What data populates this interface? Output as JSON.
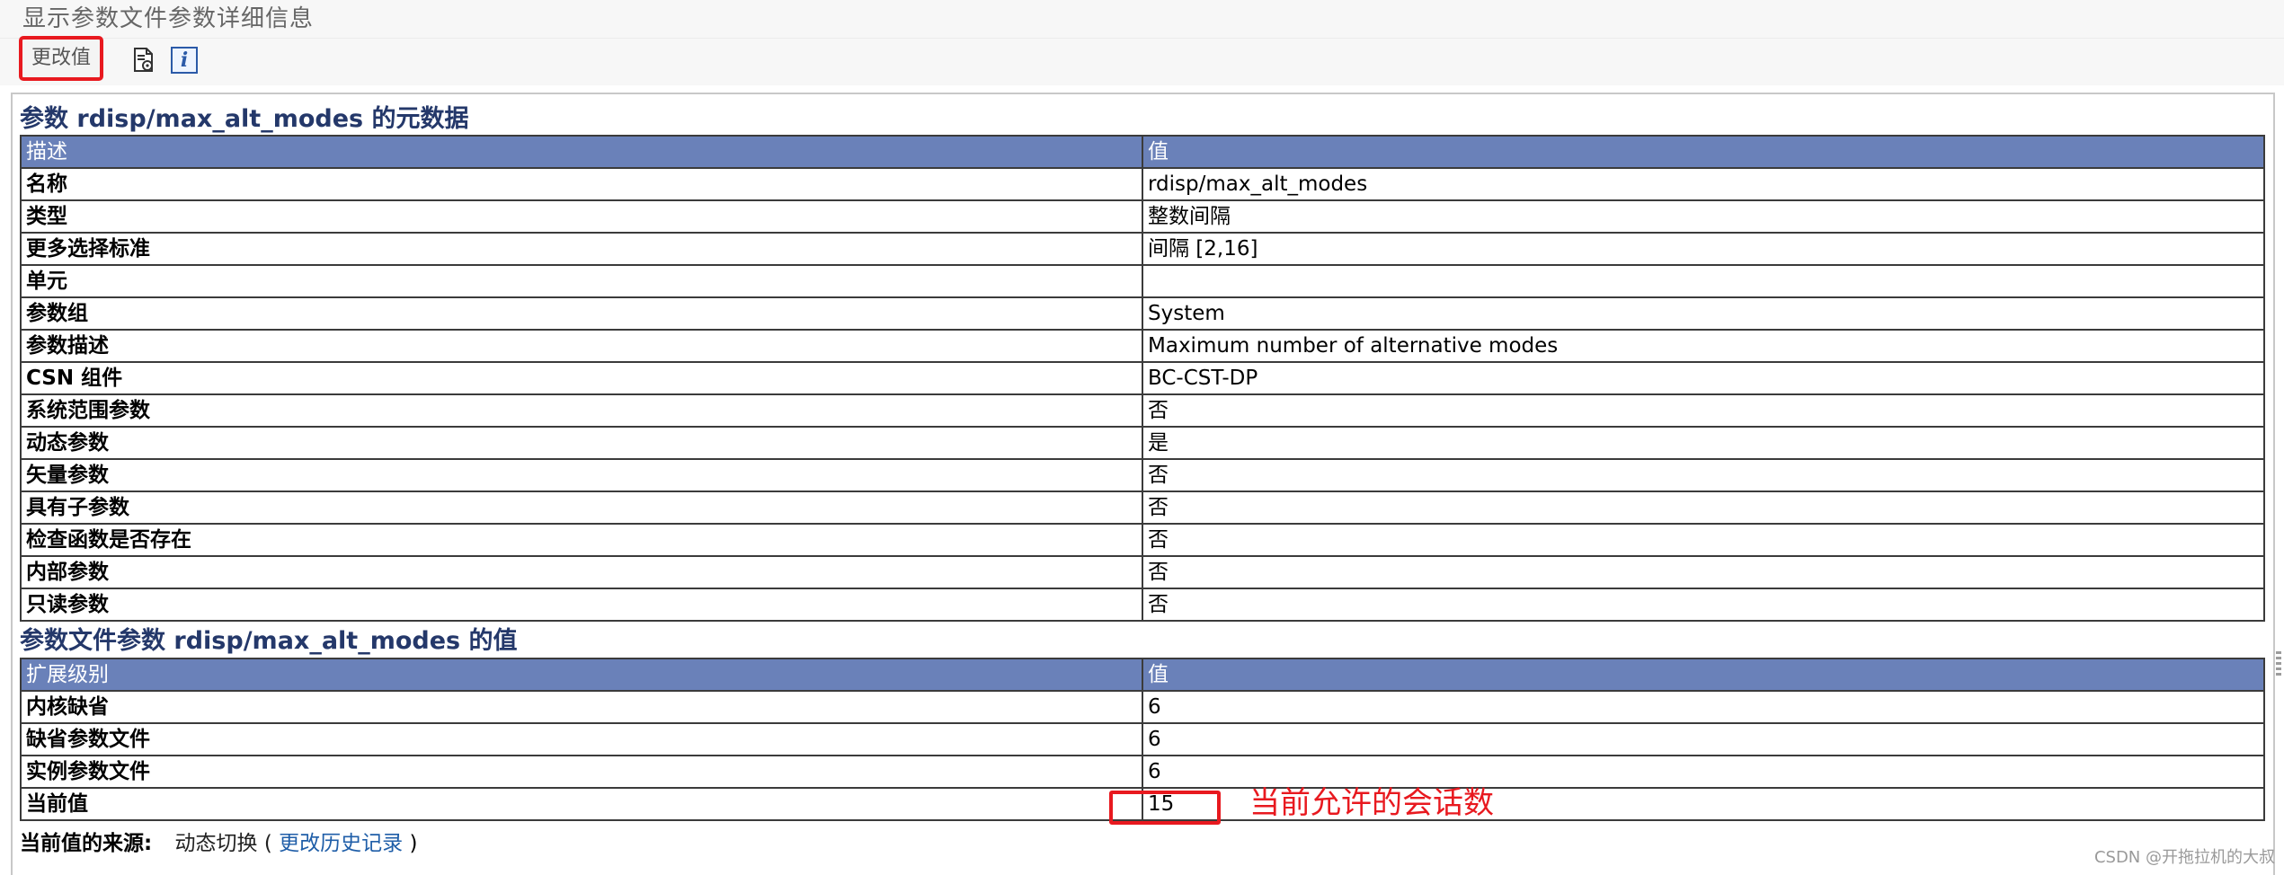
{
  "window": {
    "title": "显示参数文件参数详细信息"
  },
  "toolbar": {
    "change_value_label": "更改值",
    "icons": [
      "document-settings-icon",
      "info-icon"
    ]
  },
  "metadata_section": {
    "title": "参数 rdisp/max_alt_modes 的元数据",
    "headers": [
      "描述",
      "值"
    ],
    "rows": [
      {
        "key": "名称",
        "value": "rdisp/max_alt_modes"
      },
      {
        "key": "类型",
        "value": "整数间隔"
      },
      {
        "key": "更多选择标准",
        "value": "间隔 [2,16]"
      },
      {
        "key": "单元",
        "value": ""
      },
      {
        "key": "参数组",
        "value": "System"
      },
      {
        "key": "参数描述",
        "value": "Maximum number of alternative modes"
      },
      {
        "key": "CSN 组件",
        "value": "BC-CST-DP"
      },
      {
        "key": "系统范围参数",
        "value": "否"
      },
      {
        "key": "动态参数",
        "value": "是"
      },
      {
        "key": "矢量参数",
        "value": "否"
      },
      {
        "key": "具有子参数",
        "value": "否"
      },
      {
        "key": "检查函数是否存在",
        "value": "否"
      },
      {
        "key": "内部参数",
        "value": "否"
      },
      {
        "key": "只读参数",
        "value": "否"
      }
    ]
  },
  "values_section": {
    "title": "参数文件参数 rdisp/max_alt_modes 的值",
    "headers": [
      "扩展级别",
      "值"
    ],
    "rows": [
      {
        "key": "内核缺省",
        "value": "6"
      },
      {
        "key": "缺省参数文件",
        "value": "6"
      },
      {
        "key": "实例参数文件",
        "value": "6"
      },
      {
        "key": "当前值",
        "value": "15"
      }
    ]
  },
  "annotation": {
    "text": "当前允许的会话数",
    "color": "#e8191f"
  },
  "source": {
    "label": "当前值的来源:",
    "value_prefix": "动态切换 (",
    "link": "更改历史记录",
    "value_suffix": ")"
  },
  "watermark": "CSDN @开拖拉机的大叔",
  "colors": {
    "header_bg": "#6a81b9",
    "section_title": "#24386a",
    "highlight": "#e8191f",
    "link": "#1f5ea8"
  }
}
